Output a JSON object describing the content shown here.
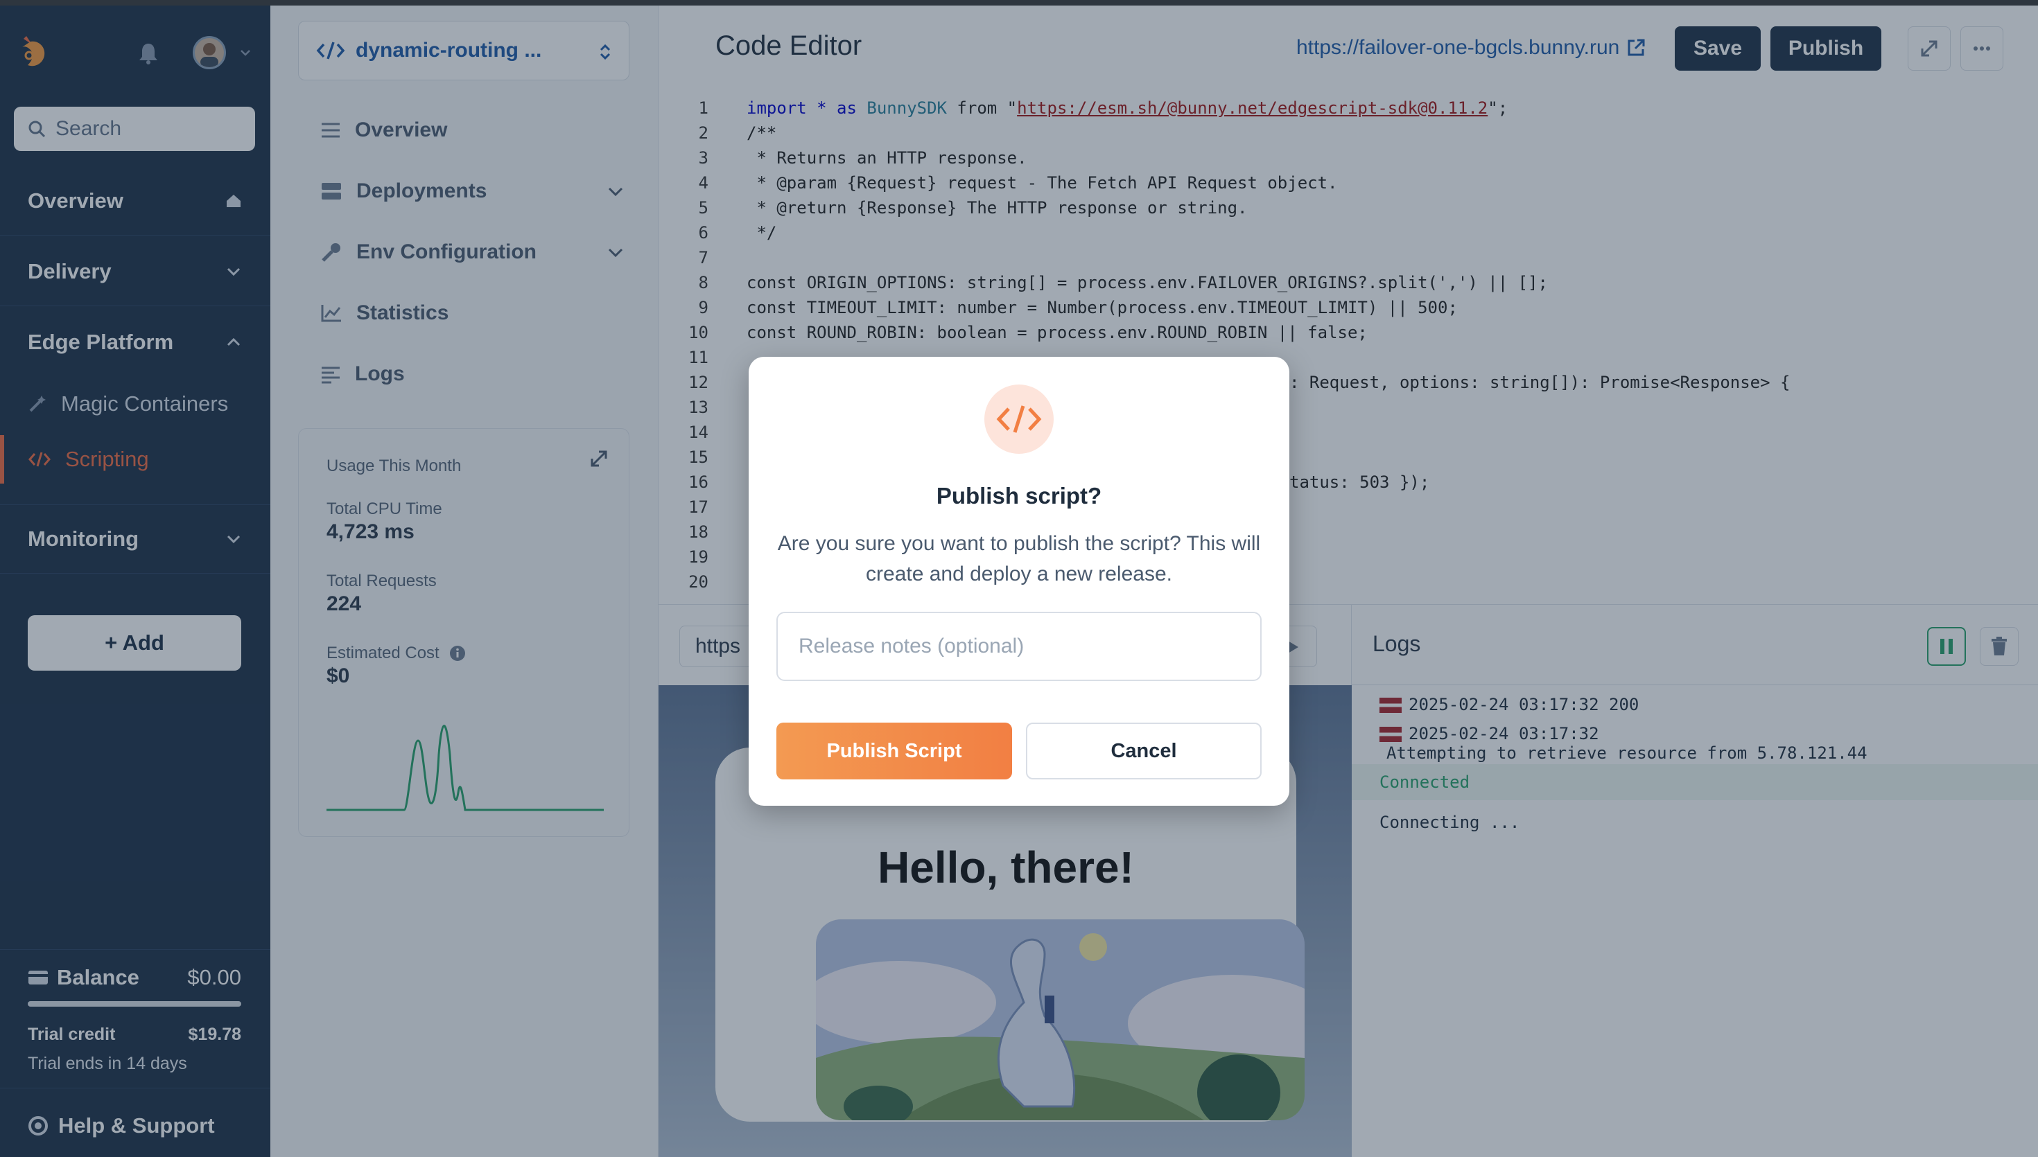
{
  "sidebar": {
    "search_placeholder": "Search",
    "sections": {
      "overview": "Overview",
      "delivery": "Delivery",
      "edge_platform": "Edge Platform",
      "monitoring": "Monitoring"
    },
    "edge_items": {
      "magic_containers": "Magic Containers",
      "scripting": "Scripting"
    },
    "add_label": "+ Add",
    "balance_label": "Balance",
    "balance_value": "$0.00",
    "trial_credit_label": "Trial credit",
    "trial_credit_value": "$19.78",
    "trial_ends": "Trial ends in 14 days",
    "help": "Help & Support",
    "accent": "#f26b42"
  },
  "panel": {
    "script_name": "dynamic-routing ...",
    "nav": {
      "overview": "Overview",
      "deployments": "Deployments",
      "env": "Env Configuration",
      "statistics": "Statistics",
      "logs": "Logs"
    },
    "usage": {
      "title": "Usage This Month",
      "cpu_label": "Total CPU Time",
      "cpu_value": "4,723 ms",
      "req_label": "Total Requests",
      "req_value": "224",
      "cost_label": "Estimated Cost",
      "cost_value": "$0"
    }
  },
  "editor": {
    "title": "Code Editor",
    "url": "https://failover-one-bgcls.bunny.run",
    "save": "Save",
    "publish": "Publish",
    "line_numbers": [
      "1",
      "2",
      "3",
      "4",
      "5",
      "6",
      "7",
      "8",
      "9",
      "10",
      "11",
      "12",
      "13",
      "14",
      "15",
      "16",
      "17",
      "18",
      "19",
      "20"
    ],
    "code": {
      "l1_a": "import * as ",
      "l1_b": "BunnySDK",
      "l1_c": " from \"",
      "l1_d": "https://esm.sh/@bunny.net/edgescript-sdk@0.11.2",
      "l1_e": "\";",
      "l2": "/**",
      "l3": " * Returns an HTTP response.",
      "l4": " * @param {Request} request - The Fetch API Request object.",
      "l5": " * @return {Response} The HTTP response or string.",
      "l6": " */",
      "l8": "const ORIGIN_OPTIONS: string[] = process.env.FAILOVER_ORIGINS?.split(',') || [];",
      "l9": "const TIMEOUT_LIMIT: number = Number(process.env.TIMEOUT_LIMIT) || 500;",
      "l10": "const ROUND_ROBIN: boolean = process.env.ROUND_ROBIN || false;",
      "l12_right": ": Request, options: string[]): Promise<Response> {",
      "l16_right": "tatus: 503 });"
    }
  },
  "preview": {
    "url_partial": "https",
    "hello": "Hello, there!"
  },
  "logs": {
    "title": "Logs",
    "entries": [
      {
        "time": "2025-02-24 03:17:32",
        "status": "200"
      },
      {
        "time": "2025-02-24 03:17:32",
        "message": "Attempting to retrieve resource from 5.78.121.44"
      }
    ],
    "connected": "Connected",
    "connecting": "Connecting ..."
  },
  "modal": {
    "title": "Publish script?",
    "message": "Are you sure you want to publish the script? This will create and deploy a new release.",
    "input_placeholder": "Release notes (optional)",
    "confirm": "Publish Script",
    "cancel": "Cancel"
  }
}
